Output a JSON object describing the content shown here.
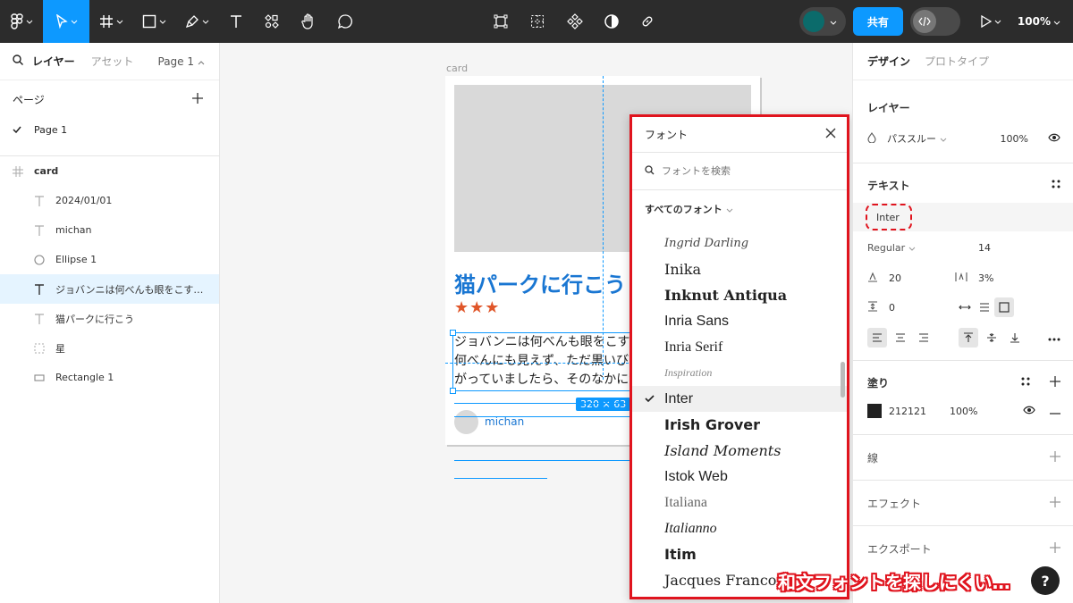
{
  "toolbar": {
    "share_label": "共有",
    "zoom_label": "100%"
  },
  "left_panel": {
    "tab_layers": "レイヤー",
    "tab_assets": "アセット",
    "page_selector": "Page 1",
    "pages_title": "ページ",
    "pages": [
      {
        "label": "Page 1",
        "selected": true
      }
    ],
    "layers": [
      {
        "label": "card",
        "icon": "frame-icon"
      },
      {
        "label": "2024/01/01",
        "icon": "text-icon"
      },
      {
        "label": "michan",
        "icon": "text-icon"
      },
      {
        "label": "Ellipse 1",
        "icon": "ellipse-icon"
      },
      {
        "label": "ジョバンニは何べんも眼をこす…",
        "icon": "text-icon",
        "selected": true
      },
      {
        "label": "猫パークに行こう",
        "icon": "text-icon"
      },
      {
        "label": "星",
        "icon": "component-icon"
      },
      {
        "label": "Rectangle 1",
        "icon": "rectangle-icon"
      }
    ]
  },
  "canvas": {
    "frame_label": "card",
    "card_title": "猫パークに行こう",
    "stars": "★★★",
    "body_text": "ジョバンニは何べんも眼をこすってみましたが、何べんにも見えず、ただ黒いびろうどの空がひろがっていましたら、そのなかに浮かんで",
    "size_badge": "320 × 63",
    "author": "michan"
  },
  "font_picker": {
    "title": "フォント",
    "search_placeholder": "フォントを検索",
    "filter_label": "すべてのフォント",
    "fonts": [
      {
        "label": "Ingrid Darling"
      },
      {
        "label": "Inika"
      },
      {
        "label": "Inknut Antiqua"
      },
      {
        "label": "Inria Sans"
      },
      {
        "label": "Inria Serif"
      },
      {
        "label": "Inspiration"
      },
      {
        "label": "Inter",
        "selected": true
      },
      {
        "label": "Irish Grover"
      },
      {
        "label": "Island Moments"
      },
      {
        "label": "Istok Web"
      },
      {
        "label": "Italiana"
      },
      {
        "label": "Italianno"
      },
      {
        "label": "Itim"
      },
      {
        "label": "Jacques Francois"
      }
    ]
  },
  "right_panel": {
    "tab_design": "デザイン",
    "tab_prototype": "プロトタイプ",
    "layer_title": "レイヤー",
    "blend_mode": "パススルー",
    "layer_opacity": "100%",
    "text_title": "テキスト",
    "font_family": "Inter",
    "font_weight": "Regular",
    "font_size": "14",
    "line_height": "20",
    "letter_spacing": "3%",
    "paragraph_spacing": "0",
    "fill_title": "塗り",
    "fill_hex": "212121",
    "fill_opacity": "100%",
    "stroke_title": "線",
    "effects_title": "エフェクト",
    "export_title": "エクスポート"
  },
  "caption": "和文フォントを探しにくい…",
  "colors": {
    "accent": "#0d99ff",
    "highlight_red": "#e0141e",
    "title_blue": "#1976d2",
    "star_orange": "#e0562a"
  }
}
